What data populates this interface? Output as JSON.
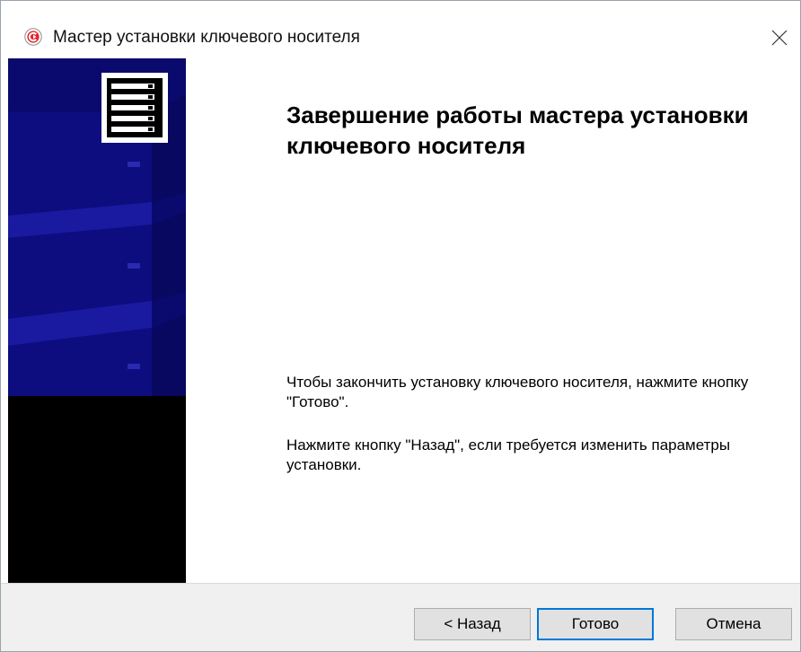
{
  "window": {
    "title": "Мастер установки ключевого носителя",
    "icon": "cryptopro-logo-icon",
    "close_icon": "close-icon"
  },
  "content": {
    "heading": "Завершение работы мастера установки ключевого носителя",
    "paragraph1": "Чтобы закончить установку ключевого носителя, нажмите кнопку \"Готово\".",
    "paragraph2": "Нажмите кнопку \"Назад\", если требуется изменить параметры установки."
  },
  "buttons": {
    "back": "< Назад",
    "finish": "Готово",
    "cancel": "Отмена"
  },
  "colors": {
    "banner_blue": "#0a0a6e",
    "focus_border": "#0078d7",
    "footer_bg": "#f0f0f0"
  }
}
